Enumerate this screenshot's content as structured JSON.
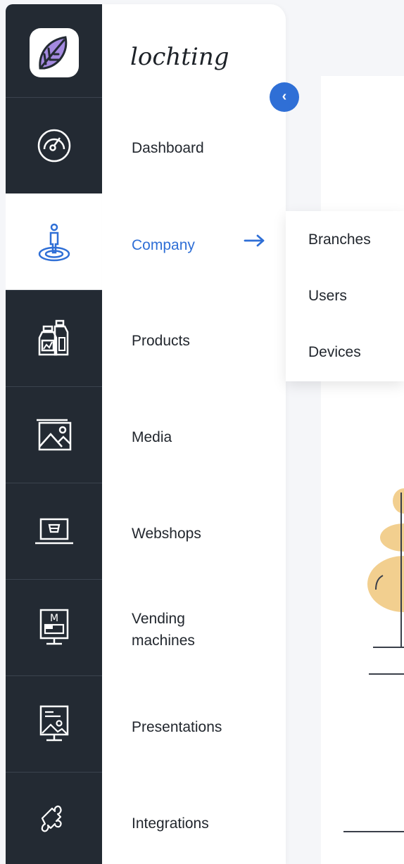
{
  "brand": {
    "name": "lochting"
  },
  "rail": {
    "icons": [
      "logo-icon",
      "speedometer-icon",
      "person-pin-icon",
      "bottles-icon",
      "image-icon",
      "laptop-cart-icon",
      "vending-machine-icon",
      "presentation-icon",
      "puzzle-icon"
    ],
    "vending_label": "M"
  },
  "menu": {
    "items": [
      {
        "label": "Dashboard"
      },
      {
        "label": "Company",
        "active": true
      },
      {
        "label": "Products"
      },
      {
        "label": "Media"
      },
      {
        "label": "Webshops"
      },
      {
        "label": "Vending machines"
      },
      {
        "label": "Presentations"
      },
      {
        "label": "Integrations"
      }
    ]
  },
  "submenu": {
    "items": [
      {
        "label": "Branches"
      },
      {
        "label": "Users"
      },
      {
        "label": "Devices"
      }
    ]
  },
  "colors": {
    "accent": "#2f6fd6",
    "rail_bg": "#232a33",
    "logo_purple": "#a48ae0",
    "illustration_sand": "#f2cf8f"
  }
}
